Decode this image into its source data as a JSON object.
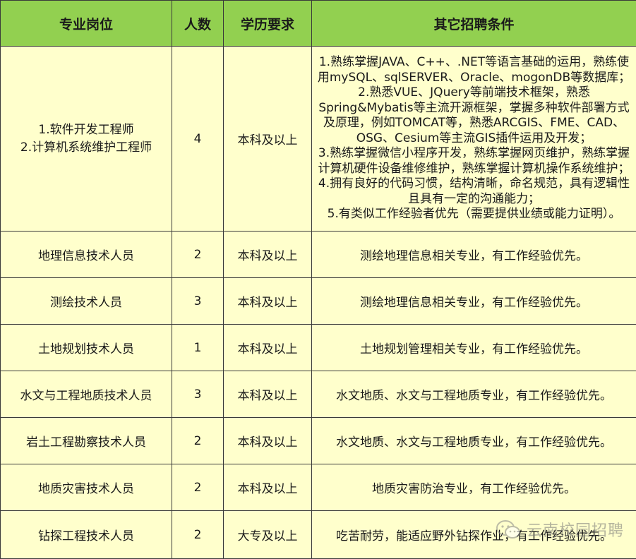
{
  "headers": {
    "position": "专业岗位",
    "count": "人数",
    "education": "学历要求",
    "requirements": "其它招聘条件"
  },
  "rows": [
    {
      "position_lines": [
        "1.软件开发工程师",
        "2.计算机系统维护工程师"
      ],
      "count": "4",
      "education": "本科及以上",
      "requirement_lines": [
        "1.熟练掌握JAVA、C++、.NET等语言基础的运用，熟练使用mySQL、sqlSERVER、Oracle、mogonDB等数据库；",
        "2.熟悉VUE、JQuery等前端技术框架，熟悉Spring&Mybatis等主流开源框架，掌握多种软件部署方式及原理，例如TOMCAT等，熟悉ARCGIS、FME、CAD、OSG、Cesium等主流GIS插件运用及开发；",
        "3.熟练掌握微信小程序开发，熟练掌握网页维护，熟练掌握计算机硬件设备维修维护，熟练掌握计算机操作系统维护；",
        "4.拥有良好的代码习惯，结构清晰，命名规范，具有逻辑性且具有一定的沟通能力；",
        "5.有类似工作经验者优先（需要提供业绩或能力证明）。"
      ]
    },
    {
      "position": "地理信息技术人员",
      "count": "2",
      "education": "本科及以上",
      "requirement": "测绘地理信息相关专业，有工作经验优先。"
    },
    {
      "position": "测绘技术人员",
      "count": "3",
      "education": "本科及以上",
      "requirement": "测绘地理信息相关专业，有工作经验优先。"
    },
    {
      "position": "土地规划技术人员",
      "count": "1",
      "education": "本科及以上",
      "requirement": "土地规划管理相关专业，有工作经验优先。"
    },
    {
      "position": "水文与工程地质技术人员",
      "count": "3",
      "education": "本科及以上",
      "requirement": "水文地质、水文与工程地质专业，有工作经验优先。"
    },
    {
      "position": "岩土工程勘察技术人员",
      "count": "2",
      "education": "本科及以上",
      "requirement": "水文地质、水文与工程地质专业，有工作经验优先。"
    },
    {
      "position": "地质灾害技术人员",
      "count": "2",
      "education": "本科及以上",
      "requirement": "地质灾害防治专业，有工作经验优先。"
    },
    {
      "position": "钻探工程技术人员",
      "count": "2",
      "education": "大专及以上",
      "requirement": "吃苦耐劳，能适应野外钻探作业，有工作经验优先。"
    }
  ],
  "watermark": {
    "text": "云南校园招聘",
    "icon": "wechat-icon"
  },
  "colors": {
    "header_bg": "#92d050",
    "cell_bg": "#ffffcc",
    "border": "#3a3a3a"
  }
}
